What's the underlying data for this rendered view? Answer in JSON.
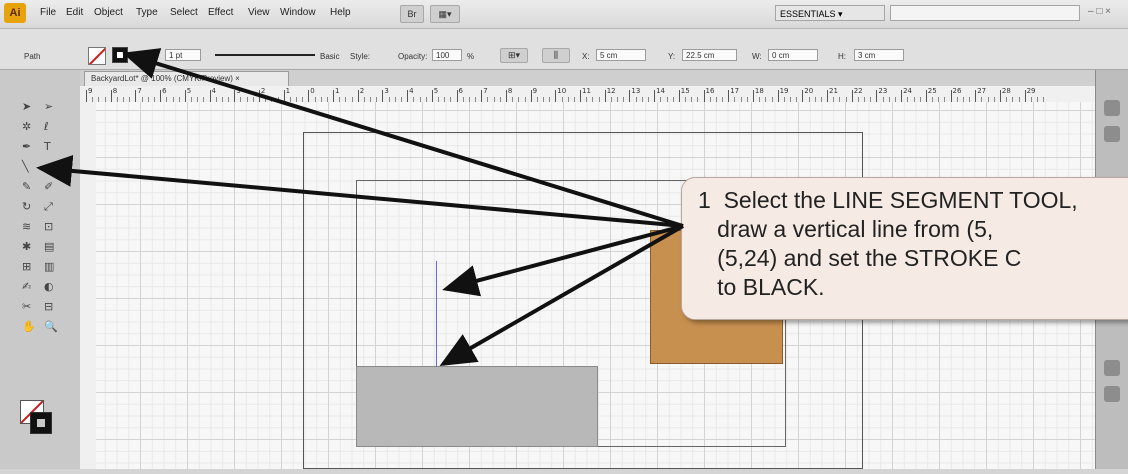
{
  "menubar": {
    "logo": "Ai",
    "items": [
      "File",
      "Edit",
      "Object",
      "Type",
      "Select",
      "Effect",
      "View",
      "Window",
      "Help"
    ],
    "workspace": "ESSENTIALS",
    "window_controls": "– □ ×"
  },
  "control_bar": {
    "object_type": "Path",
    "stroke_label": "Stroke:",
    "stroke_weight": "1 pt",
    "profile_label": "Basic",
    "style_label": "Style:",
    "opacity_label": "Opacity:",
    "opacity_value": "100",
    "opacity_unit": "%",
    "x_value": "5 cm",
    "y_value": "22.5 cm",
    "w_value": "0 cm",
    "h_value": "3 cm"
  },
  "document": {
    "tab_title": "BackyardLot* @ 100% (CMYK/Preview)"
  },
  "ruler": {
    "labels": [
      "9",
      "8",
      "7",
      "6",
      "5",
      "4",
      "3",
      "2",
      "1",
      "0",
      "1",
      "2",
      "3",
      "4",
      "5",
      "6",
      "7",
      "8",
      "9",
      "10",
      "11",
      "12",
      "13",
      "14",
      "15",
      "16",
      "17",
      "18",
      "19",
      "20",
      "21",
      "22",
      "23",
      "24",
      "25",
      "26",
      "27",
      "28",
      "29"
    ]
  },
  "callout": {
    "step_number": "1",
    "text": "Select the LINE SEGMENT TOOL,\n   draw a vertical line from (5,\n   (5,24) and set the STROKE C\n   to BLACK."
  },
  "colors": {
    "orange_shape": "#c8904f",
    "grey_shape": "#b8b8b8",
    "callout_bg": "#f6ebe4",
    "stroke_swatch": "#111111"
  }
}
